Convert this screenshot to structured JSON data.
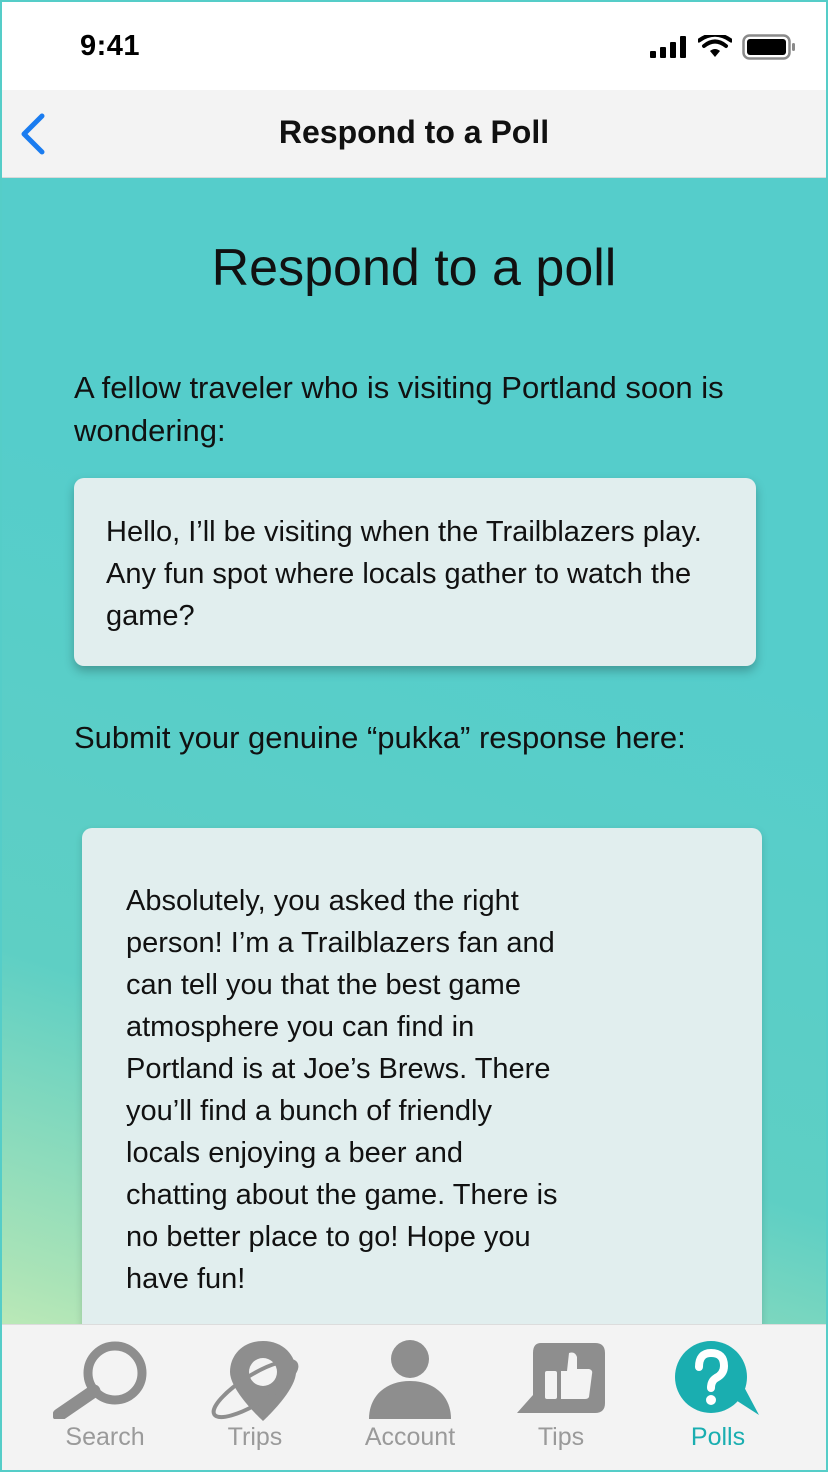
{
  "status_bar": {
    "time": "9:41"
  },
  "nav": {
    "title": "Respond to a Poll"
  },
  "main": {
    "heading": "Respond to a poll",
    "intro": "A fellow traveler who is visiting Portland soon is wondering:",
    "question": "Hello, I’ll be visiting when the Trailblazers play. Any fun spot where locals gather to watch the game?",
    "prompt": "Submit your genuine “pukka” response here:",
    "response": "Absolutely, you asked the right\nperson! I’m a Trailblazers fan and\ncan tell you that the best game\natmosphere you can find in\nPortland is at Joe’s Brews. There\nyou’ll find a bunch of friendly\nlocals enjoying a beer and\nchatting about the game. There is\nno better place to go! Hope you\nhave fun!"
  },
  "tabs": [
    {
      "label": "Search",
      "icon": "magnifier-icon",
      "active": false
    },
    {
      "label": "Trips",
      "icon": "planet-pin-icon",
      "active": false
    },
    {
      "label": "Account",
      "icon": "person-icon",
      "active": false
    },
    {
      "label": "Tips",
      "icon": "thumbs-up-icon",
      "active": false
    },
    {
      "label": "Polls",
      "icon": "question-bubble-icon",
      "active": true
    }
  ],
  "colors": {
    "accent": "#1aaeb0",
    "back_arrow": "#1a7cf0",
    "background": "#55cdcb",
    "inactive_tab": "#9a9a9a"
  }
}
